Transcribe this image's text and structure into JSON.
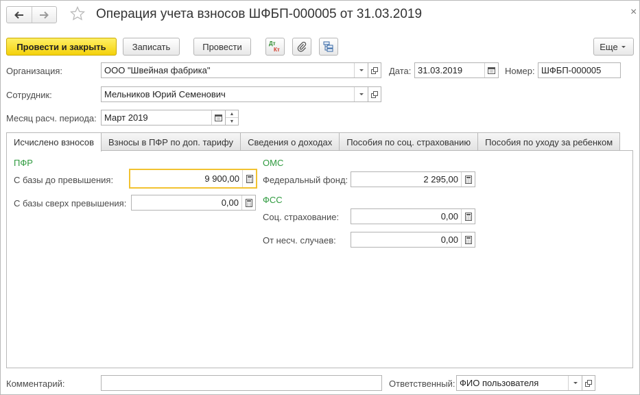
{
  "window": {
    "title": "Операция учета взносов ШФБП-000005 от 31.03.2019"
  },
  "toolbar": {
    "post_close": "Провести и закрыть",
    "save": "Записать",
    "post": "Провести",
    "more": "Еще"
  },
  "header": {
    "org_label": "Организация:",
    "org_value": "ООО \"Швейная фабрика\"",
    "date_label": "Дата:",
    "date_value": "31.03.2019",
    "number_label": "Номер:",
    "number_value": "ШФБП-000005",
    "employee_label": "Сотрудник:",
    "employee_value": "Мельников Юрий Семенович",
    "month_label": "Месяц расч. периода:",
    "month_value": "Март 2019"
  },
  "tabs": [
    {
      "label": "Исчислено взносов"
    },
    {
      "label": "Взносы в ПФР по доп. тарифу"
    },
    {
      "label": "Сведения о доходах"
    },
    {
      "label": "Пособия по соц. страхованию"
    },
    {
      "label": "Пособия по уходу за ребенком"
    }
  ],
  "pfr": {
    "title": "ПФР",
    "base_below_label": "С базы до превышения:",
    "base_below_value": "9 900,00",
    "base_above_label": "С базы сверх превышения:",
    "base_above_value": "0,00"
  },
  "oms": {
    "title": "ОМС",
    "federal_label": "Федеральный фонд:",
    "federal_value": "2 295,00"
  },
  "fss": {
    "title": "ФСС",
    "social_label": "Соц. страхование:",
    "social_value": "0,00",
    "accident_label": "От несч. случаев:",
    "accident_value": "0,00"
  },
  "footer": {
    "comment_label": "Комментарий:",
    "comment_value": "",
    "responsible_label": "Ответственный:",
    "responsible_value": "ФИО пользователя"
  },
  "icons": {
    "dtkt_top": "Дт",
    "dtkt_bottom": "Кт"
  },
  "colors": {
    "primary_button": "#f4d10a",
    "section_title": "#2e9a3e",
    "focus_border": "#f2c230"
  }
}
